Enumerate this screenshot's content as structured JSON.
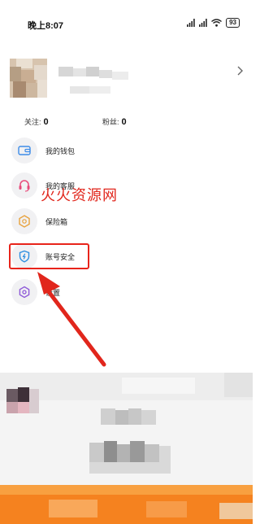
{
  "status_bar": {
    "time": "晚上8:07",
    "battery": "93",
    "icons": [
      "signal-icon",
      "signal-icon",
      "wifi-icon",
      "battery-icon"
    ]
  },
  "profile": {
    "follow_label": "关注:",
    "follow_count": "0",
    "fans_label": "粉丝:",
    "fans_count": "0"
  },
  "menu": {
    "items": [
      {
        "label": "我的钱包",
        "icon": "wallet-icon",
        "color": "#3d8ce8"
      },
      {
        "label": "我的客服",
        "icon": "headset-icon",
        "color": "#e84a7a"
      },
      {
        "label": "保险箱",
        "icon": "safe-box-icon",
        "color": "#e8a23d"
      },
      {
        "label": "账号安全",
        "icon": "shield-icon",
        "color": "#2e8fe0"
      },
      {
        "label": "设置",
        "icon": "gear-icon",
        "color": "#8e5ad8"
      }
    ]
  },
  "annotation": {
    "watermark": "火火资源网",
    "highlight_color": "#e8241b"
  }
}
